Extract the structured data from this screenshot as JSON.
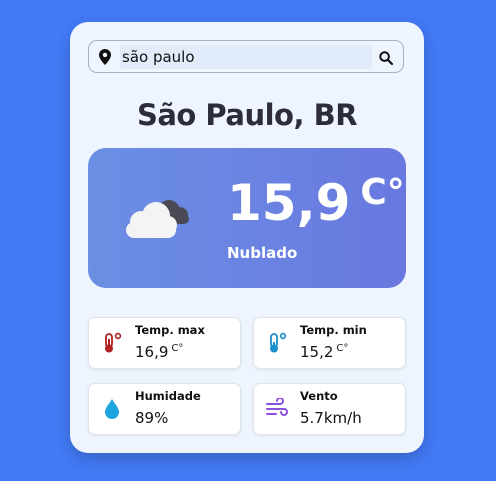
{
  "search": {
    "value": "são paulo"
  },
  "location": {
    "title": "São Paulo, BR"
  },
  "current": {
    "temperature": "15,9",
    "unit": "C°",
    "condition": "Nublado",
    "icon": "cloud-icon"
  },
  "stats": {
    "temp_max": {
      "label": "Temp. max",
      "value": "16,9",
      "unit": "C°",
      "icon": "thermometer-hot-icon"
    },
    "temp_min": {
      "label": "Temp. min",
      "value": "15,2",
      "unit": "C°",
      "icon": "thermometer-cold-icon"
    },
    "humidity": {
      "label": "Humidade",
      "value": "89%",
      "icon": "water-drop-icon"
    },
    "wind": {
      "label": "Vento",
      "value": "5.7km/h",
      "icon": "wind-icon"
    }
  },
  "colors": {
    "background": "#4279f4",
    "card": "#eef5fe",
    "hero_gradient_start": "#6b8fe3",
    "hero_gradient_end": "#6978e0",
    "thermometer_hot": "#b32020",
    "thermometer_cold": "#1a8fc9",
    "humidity": "#1ea5e0",
    "wind": "#8a4fe0"
  }
}
